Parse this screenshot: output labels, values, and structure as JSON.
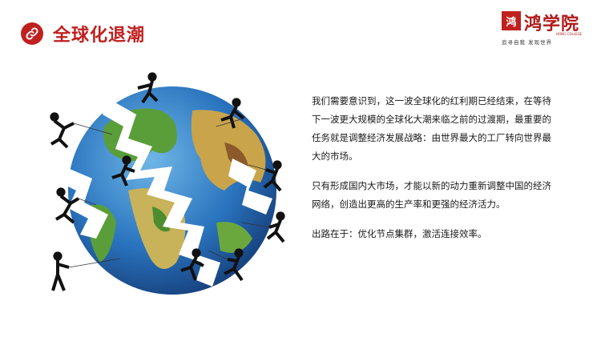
{
  "header": {
    "icon": "link-icon",
    "title": "全球化退潮",
    "accent_color": "#c0201f"
  },
  "logo": {
    "seal_char": "鸿",
    "name": "鸿学院",
    "english": "HONG COLLEGE",
    "slogan": "追寻自我  发现世界"
  },
  "illustration": {
    "description_icon": "cracked-globe-icon"
  },
  "content": {
    "paragraph_1": "我们需要意识到，这一波全球化的红利期已经结束，在等待下一波更大规模的全球化大潮来临之前的过渡期，最重要的任务就是调整经济发展战略：由世界最大的工厂转向世界最大的市场。",
    "paragraph_2": "只有形成国内大市场，才能以新的动力重新调整中国的经济网络，创造出更高的生产率和更强的经济活力。",
    "paragraph_3": "出路在于：优化节点集群，激活连接效率。"
  }
}
